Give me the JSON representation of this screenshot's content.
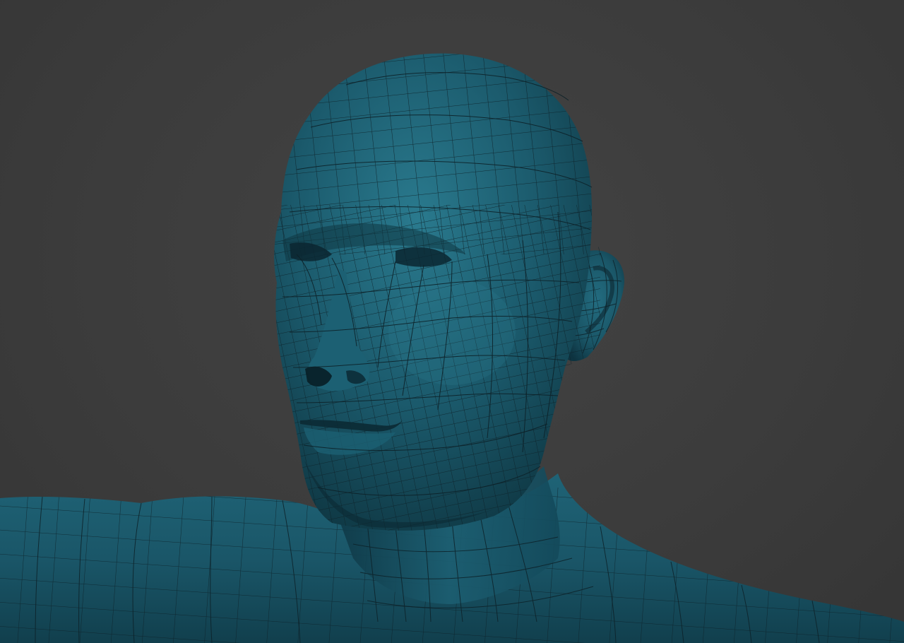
{
  "scene": {
    "background_color": "#3b3b3b",
    "mesh_color": "#1b5566",
    "mesh_highlight_color": "#2a7386",
    "mesh_shadow_color": "#0c2d38",
    "wire_color": "#0d2128",
    "model": "human-bust-wireframe"
  }
}
